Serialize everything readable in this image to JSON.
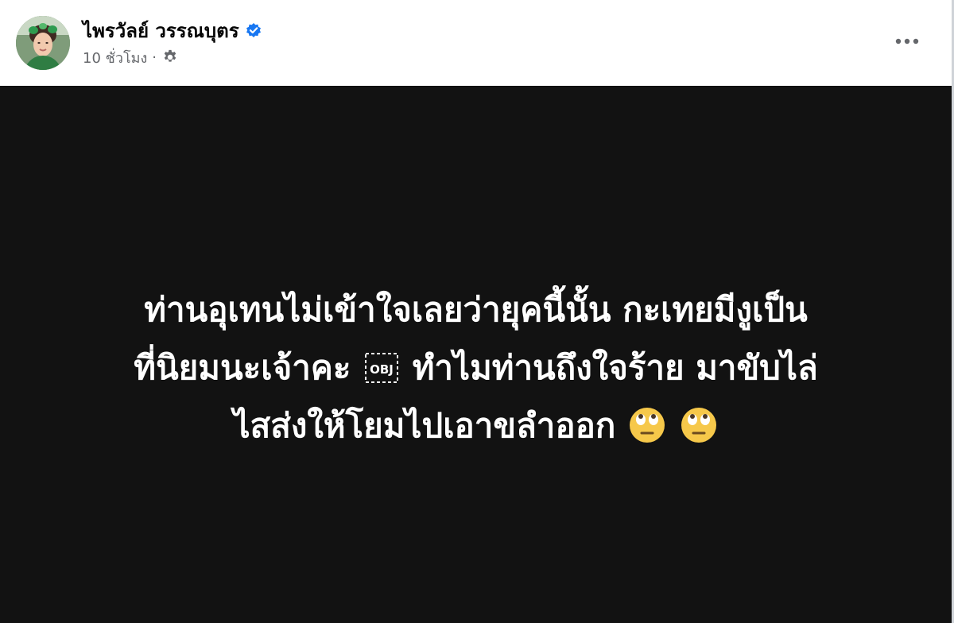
{
  "post": {
    "author_name": "ไพรวัลย์ วรรณบุตร",
    "timestamp": "10 ชั่วโมง",
    "separator": "·",
    "privacy_icon": "gear-icon",
    "verified_icon": "verified-badge-icon",
    "more_icon": "more-options-icon"
  },
  "status_image": {
    "lines": [
      "ท่านอุเทนไม่เข้าใจเลยว่ายุคนี้นั้น กะเทยมีงูเป็น",
      "ที่นิยมนะเจ้าคะ",
      "ทำไมท่านถึงใจร้าย มาขับไล่",
      "ไสส่งให้โยมไปเอาขลำออก"
    ],
    "placeholder_glyph": "OBJ",
    "emoji": "eye-roll-emoji",
    "background_color": "#121212",
    "text_color": "#ffffff"
  },
  "colors": {
    "accent": "#1877f2",
    "secondary_text": "#65676b"
  }
}
